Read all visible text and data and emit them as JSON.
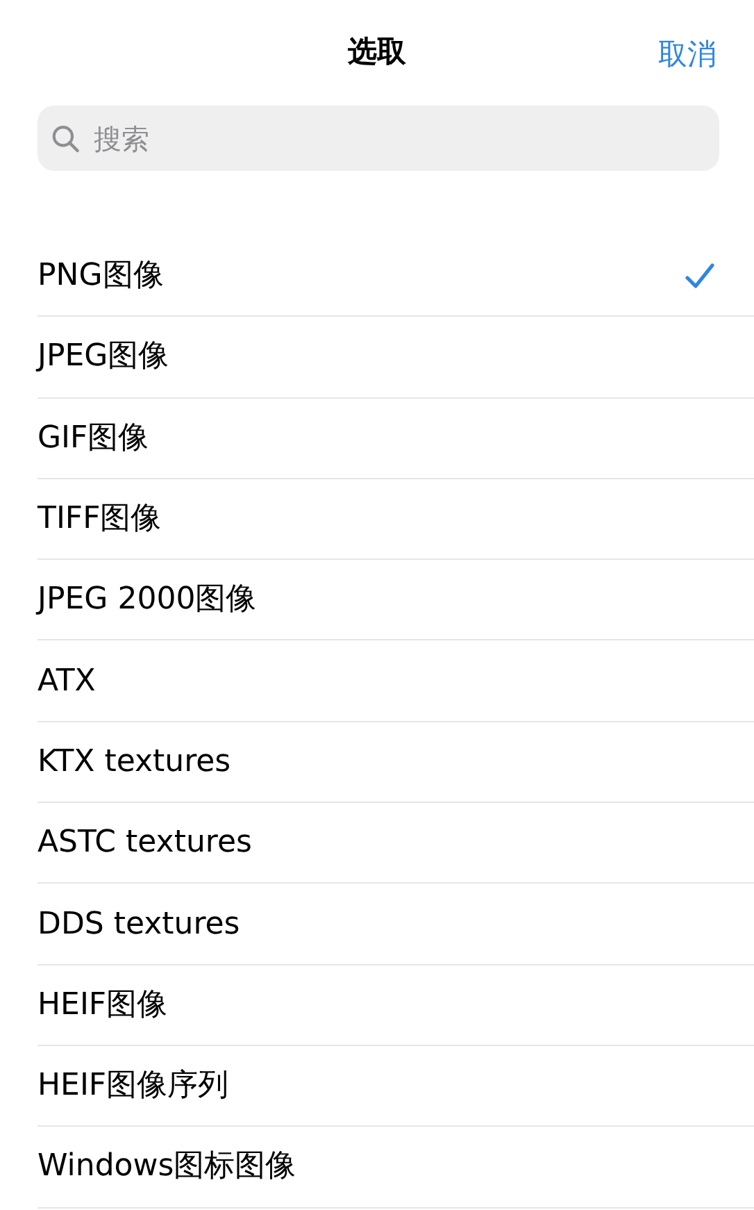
{
  "header": {
    "title": "选取",
    "cancel": "取消"
  },
  "search": {
    "placeholder": "搜索"
  },
  "items": [
    {
      "label": "PNG图像",
      "selected": true
    },
    {
      "label": "JPEG图像",
      "selected": false
    },
    {
      "label": "GIF图像",
      "selected": false
    },
    {
      "label": "TIFF图像",
      "selected": false
    },
    {
      "label": "JPEG 2000图像",
      "selected": false
    },
    {
      "label": "ATX",
      "selected": false
    },
    {
      "label": "KTX textures",
      "selected": false
    },
    {
      "label": "ASTC textures",
      "selected": false
    },
    {
      "label": "DDS textures",
      "selected": false
    },
    {
      "label": "HEIF图像",
      "selected": false
    },
    {
      "label": "HEIF图像序列",
      "selected": false
    },
    {
      "label": "Windows图标图像",
      "selected": false
    }
  ]
}
